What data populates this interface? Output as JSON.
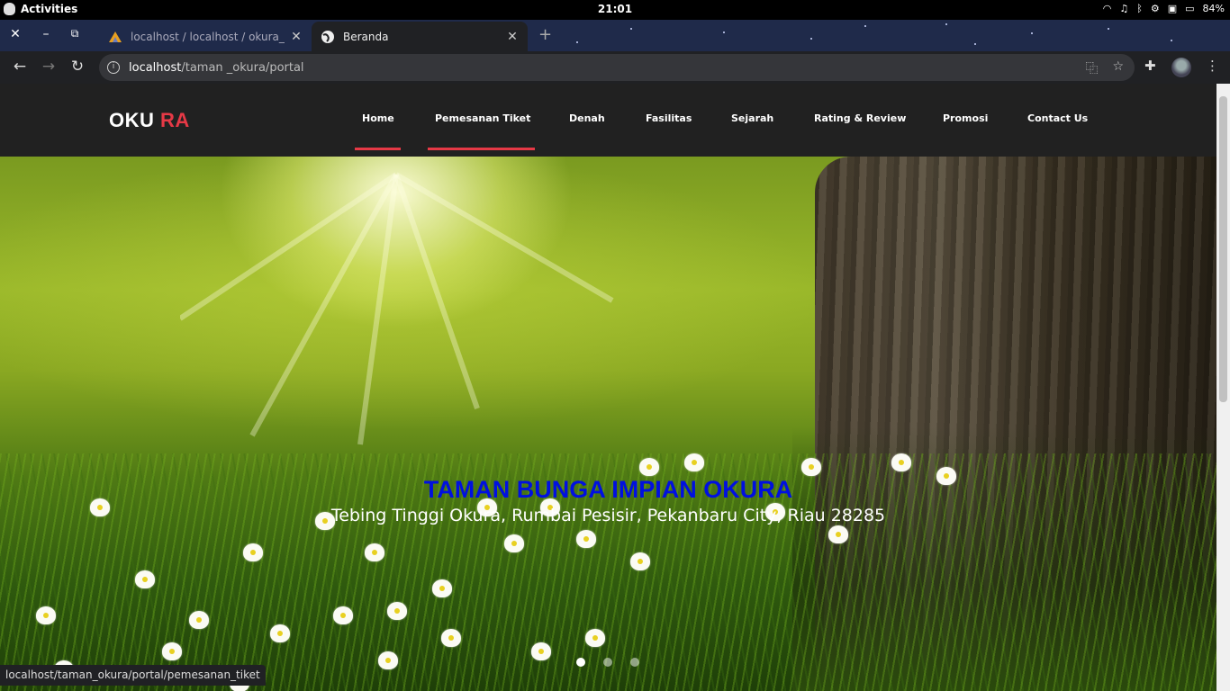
{
  "system": {
    "activities": "Activities",
    "clock": "21:01",
    "battery": "84%"
  },
  "browser": {
    "tabs": [
      {
        "title": "localhost / localhost / okura_",
        "active": false,
        "icon": "phpmyadmin-icon"
      },
      {
        "title": "Beranda",
        "active": true,
        "icon": "globe-icon"
      }
    ],
    "url_host": "localhost",
    "url_path": "/taman _okura/portal",
    "status_url": "localhost/taman_okura/portal/pemesanan_tiket"
  },
  "site": {
    "brand_part1": "OKU",
    "brand_part2": "RA",
    "menu": [
      {
        "label": "Home",
        "active": true
      },
      {
        "label": "Pemesanan Tiket",
        "active": true
      },
      {
        "label": "Denah",
        "active": false
      },
      {
        "label": "Fasilitas",
        "active": false
      },
      {
        "label": "Sejarah",
        "active": false
      },
      {
        "label": "Rating & Review",
        "active": false
      },
      {
        "label": "Promosi",
        "active": false
      },
      {
        "label": "Contact Us",
        "active": false
      }
    ],
    "hero": {
      "title": "TAMAN BUNGA IMPIAN OKURA",
      "subtitle": "Tebing Tinggi Okura, Rumbai Pesisir, Pekanbaru City, Riau 28285",
      "slides": 3,
      "active_slide": 1
    }
  },
  "colors": {
    "accent": "#e63946",
    "nav_bg": "#212121",
    "hero_title": "#0010e0"
  }
}
